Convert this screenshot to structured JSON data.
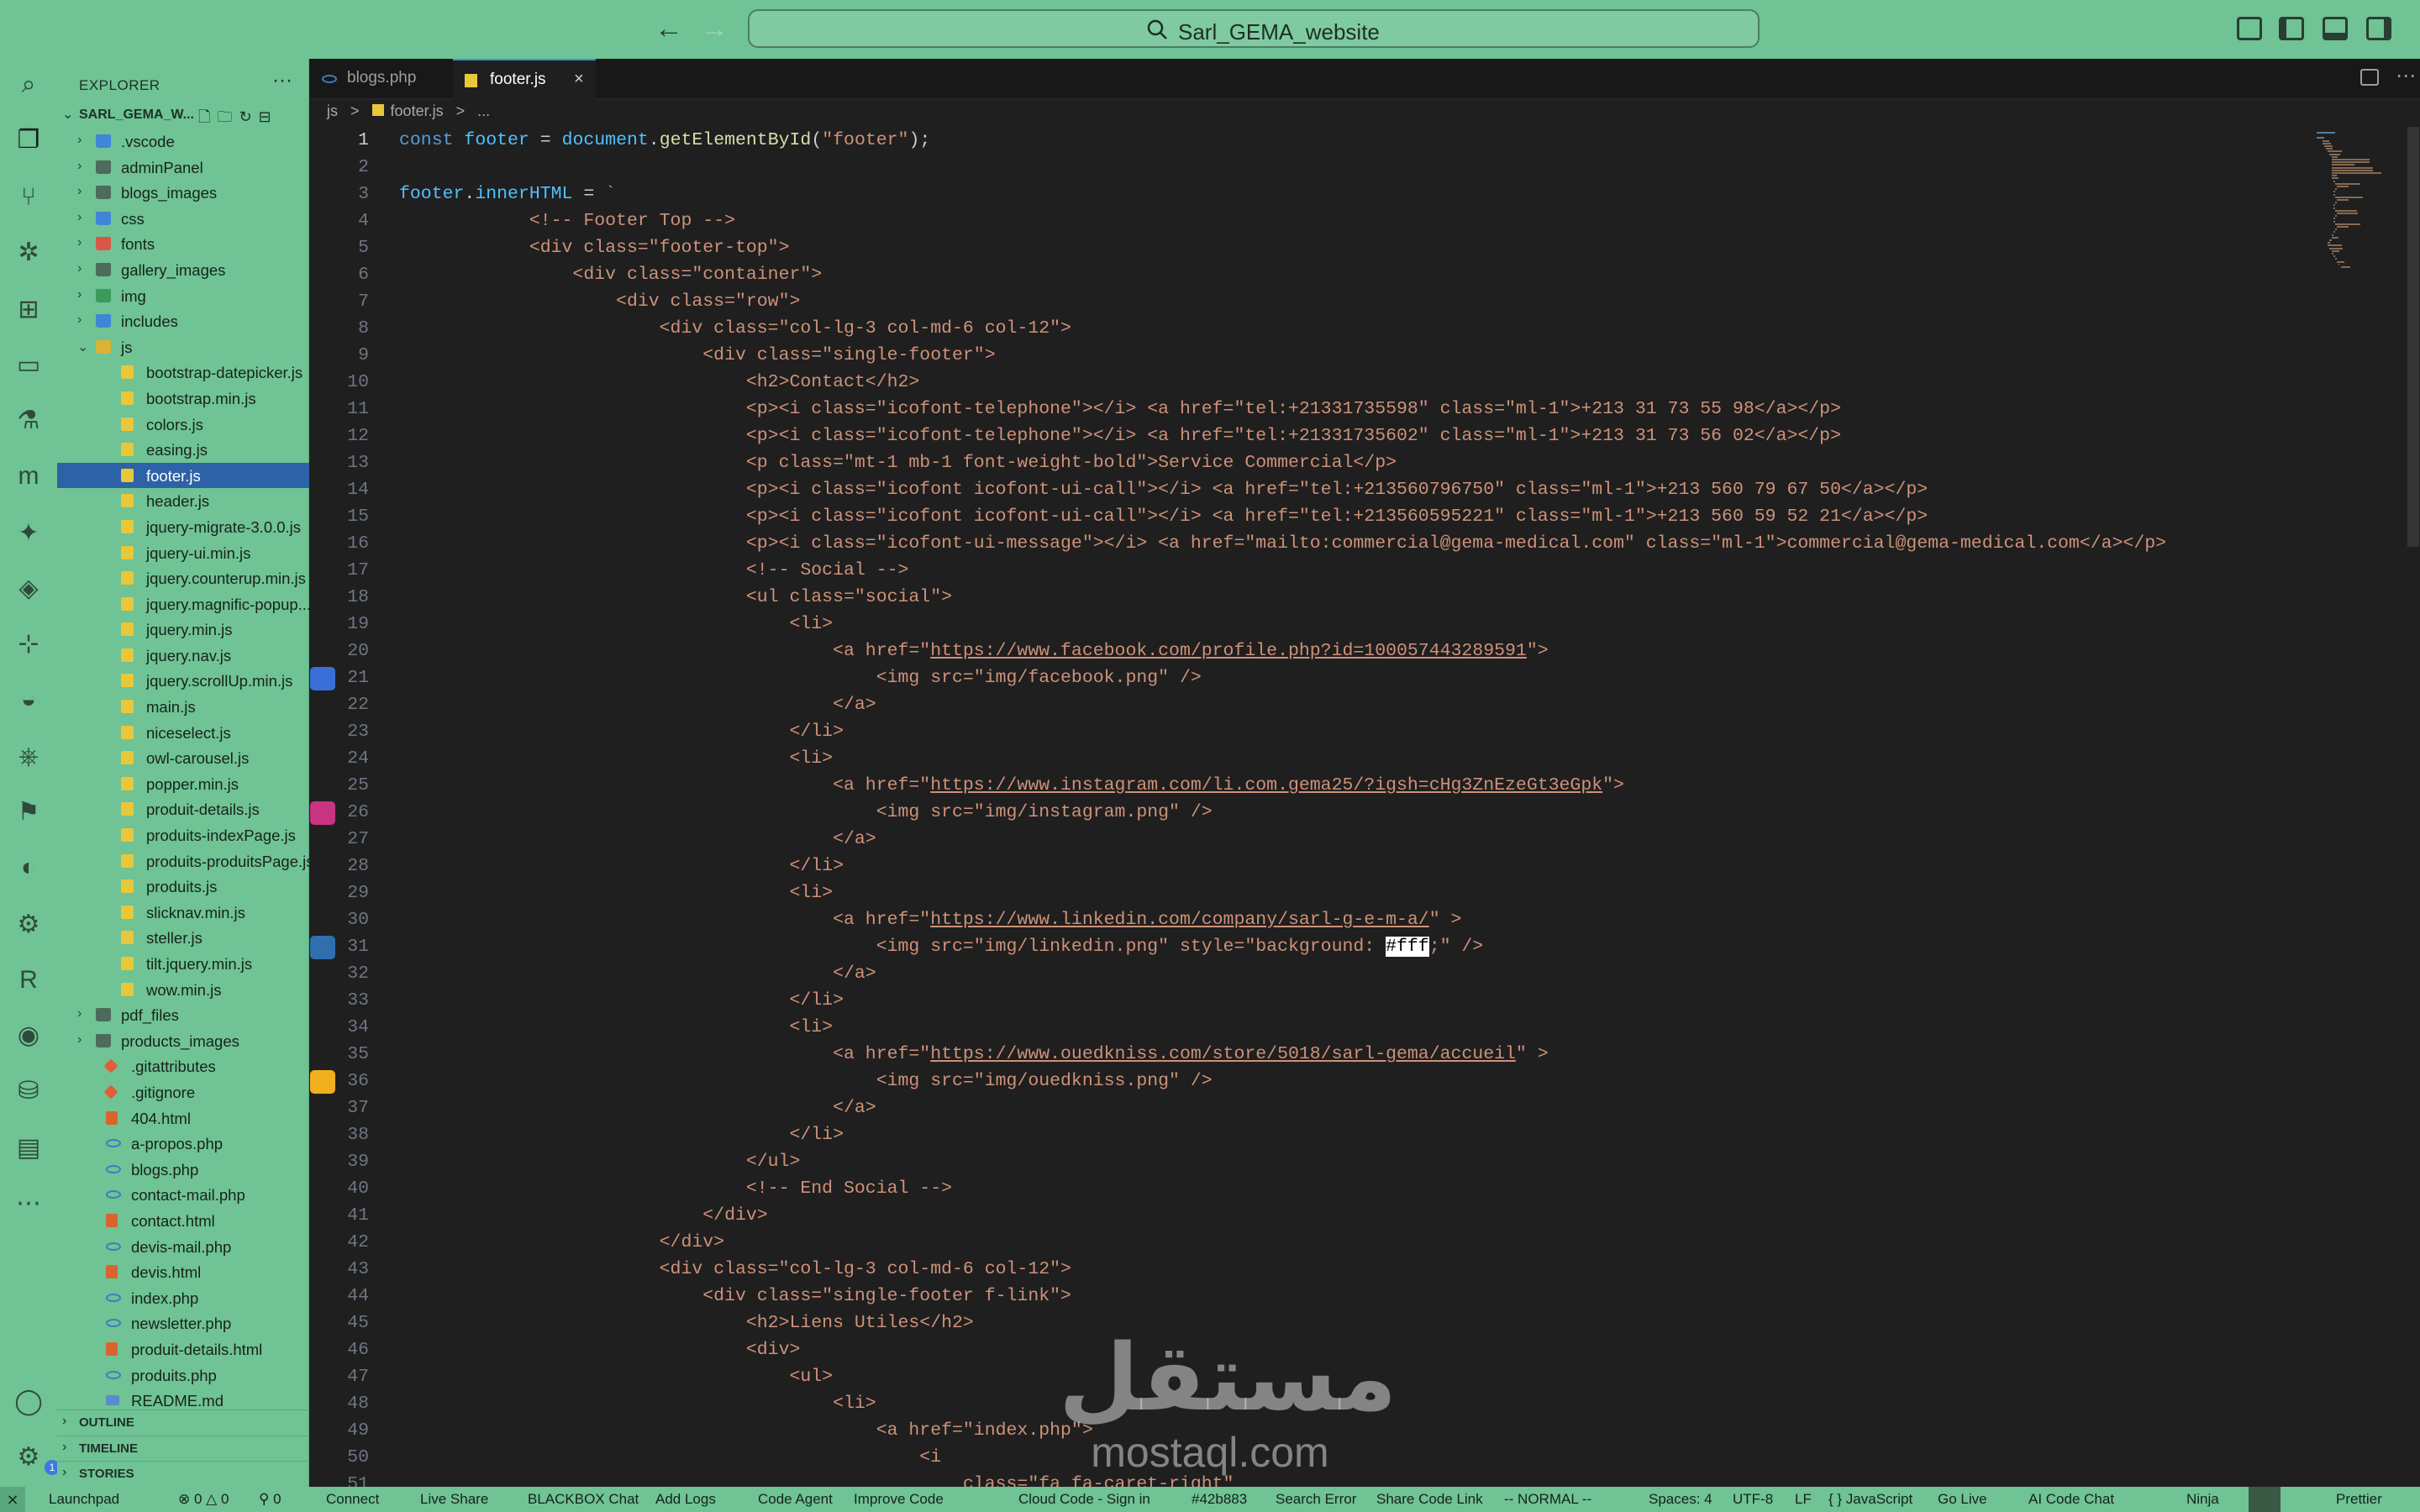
{
  "titlebar": {
    "back_icon": "arrow-left-icon",
    "forward_icon": "arrow-right-icon",
    "search_text": "Sarl_GEMA_website",
    "layout_icons": [
      "customize-layout-icon",
      "toggle-primary-sidebar-icon",
      "toggle-panel-icon",
      "toggle-secondary-sidebar-icon"
    ]
  },
  "activitybar": {
    "items": [
      "search-icon",
      "explorer-icon",
      "source-control-icon",
      "run-debug-icon",
      "extensions-icon",
      "remote-explorer-icon",
      "testing-icon",
      "m-icon",
      "sparkle-icon",
      "python-icon",
      "docker-icon",
      "whale-icon",
      "kubernetes-icon",
      "flag-icon",
      "edge-icon",
      "gear-app-icon",
      "r-icon",
      "github-icon",
      "database-icon",
      "stack-icon",
      "more-icon"
    ],
    "accounts_icon": "account-icon",
    "manage_icon": "manage-gear-icon",
    "manage_badge": "1"
  },
  "sidebar": {
    "title": "EXPLORER",
    "more": "···",
    "root": "SARL_GEMA_W...",
    "tree": [
      {
        "type": "folder",
        "name": ".vscode",
        "color": "blue",
        "depth": 0,
        "open": false
      },
      {
        "type": "folder",
        "name": "adminPanel",
        "color": "plain",
        "depth": 0,
        "open": false
      },
      {
        "type": "folder",
        "name": "blogs_images",
        "color": "plain",
        "depth": 0,
        "open": false
      },
      {
        "type": "folder",
        "name": "css",
        "color": "blue",
        "depth": 0,
        "open": false
      },
      {
        "type": "folder",
        "name": "fonts",
        "color": "red",
        "depth": 0,
        "open": false
      },
      {
        "type": "folder",
        "name": "gallery_images",
        "color": "plain",
        "depth": 0,
        "open": false
      },
      {
        "type": "folder",
        "name": "img",
        "color": "green",
        "depth": 0,
        "open": false
      },
      {
        "type": "folder",
        "name": "includes",
        "color": "blue",
        "depth": 0,
        "open": false
      },
      {
        "type": "folder",
        "name": "js",
        "color": "js",
        "depth": 0,
        "open": true
      },
      {
        "type": "js",
        "name": "bootstrap-datepicker.js",
        "depth": 1
      },
      {
        "type": "js",
        "name": "bootstrap.min.js",
        "depth": 1
      },
      {
        "type": "js",
        "name": "colors.js",
        "depth": 1
      },
      {
        "type": "js",
        "name": "easing.js",
        "depth": 1
      },
      {
        "type": "js",
        "name": "footer.js",
        "depth": 1,
        "selected": true
      },
      {
        "type": "js",
        "name": "header.js",
        "depth": 1
      },
      {
        "type": "js",
        "name": "jquery-migrate-3.0.0.js",
        "depth": 1
      },
      {
        "type": "js",
        "name": "jquery-ui.min.js",
        "depth": 1
      },
      {
        "type": "js",
        "name": "jquery.counterup.min.js",
        "depth": 1
      },
      {
        "type": "js",
        "name": "jquery.magnific-popup....",
        "depth": 1
      },
      {
        "type": "js",
        "name": "jquery.min.js",
        "depth": 1
      },
      {
        "type": "js",
        "name": "jquery.nav.js",
        "depth": 1
      },
      {
        "type": "js",
        "name": "jquery.scrollUp.min.js",
        "depth": 1
      },
      {
        "type": "js",
        "name": "main.js",
        "depth": 1
      },
      {
        "type": "js",
        "name": "niceselect.js",
        "depth": 1
      },
      {
        "type": "js",
        "name": "owl-carousel.js",
        "depth": 1
      },
      {
        "type": "js",
        "name": "popper.min.js",
        "depth": 1
      },
      {
        "type": "js",
        "name": "produit-details.js",
        "depth": 1
      },
      {
        "type": "js",
        "name": "produits-indexPage.js",
        "depth": 1
      },
      {
        "type": "js",
        "name": "produits-produitsPage.js",
        "depth": 1
      },
      {
        "type": "js",
        "name": "produits.js",
        "depth": 1
      },
      {
        "type": "js",
        "name": "slicknav.min.js",
        "depth": 1
      },
      {
        "type": "js",
        "name": "steller.js",
        "depth": 1
      },
      {
        "type": "js",
        "name": "tilt.jquery.min.js",
        "depth": 1
      },
      {
        "type": "js",
        "name": "wow.min.js",
        "depth": 1
      },
      {
        "type": "folder",
        "name": "pdf_files",
        "color": "plain",
        "depth": 0,
        "open": false
      },
      {
        "type": "folder",
        "name": "products_images",
        "color": "plain",
        "depth": 0,
        "open": false
      },
      {
        "type": "git",
        "name": ".gitattributes",
        "depth": 0
      },
      {
        "type": "git",
        "name": ".gitignore",
        "depth": 0
      },
      {
        "type": "html",
        "name": "404.html",
        "depth": 0
      },
      {
        "type": "php",
        "name": "a-propos.php",
        "depth": 0
      },
      {
        "type": "php",
        "name": "blogs.php",
        "depth": 0
      },
      {
        "type": "php",
        "name": "contact-mail.php",
        "depth": 0
      },
      {
        "type": "html",
        "name": "contact.html",
        "depth": 0
      },
      {
        "type": "php",
        "name": "devis-mail.php",
        "depth": 0
      },
      {
        "type": "html",
        "name": "devis.html",
        "depth": 0
      },
      {
        "type": "php",
        "name": "index.php",
        "depth": 0
      },
      {
        "type": "php",
        "name": "newsletter.php",
        "depth": 0
      },
      {
        "type": "html",
        "name": "produit-details.html",
        "depth": 0
      },
      {
        "type": "php",
        "name": "produits.php",
        "depth": 0
      },
      {
        "type": "md",
        "name": "README.md",
        "depth": 0
      }
    ],
    "sections": [
      "OUTLINE",
      "TIMELINE",
      "STORIES"
    ]
  },
  "editor": {
    "tabs": [
      {
        "label": "blogs.php",
        "active": false
      },
      {
        "label": "footer.js",
        "active": true
      }
    ],
    "close_glyph": "×",
    "breadcrumb": [
      "js",
      ">",
      "footer.js",
      ">",
      "..."
    ],
    "current_line": 1,
    "lines": [
      [
        [
          "kw",
          "const "
        ],
        [
          "var",
          "footer"
        ],
        [
          "p",
          " = "
        ],
        [
          "var",
          "document"
        ],
        [
          "p",
          "."
        ],
        [
          "fn",
          "getElementById"
        ],
        [
          "p",
          "("
        ],
        [
          "str",
          "\"footer\""
        ],
        [
          "p",
          ");"
        ]
      ],
      [],
      [
        [
          "var",
          "footer"
        ],
        [
          "p",
          "."
        ],
        [
          "var",
          "innerHTML"
        ],
        [
          "p",
          " = "
        ],
        [
          "str",
          "`"
        ]
      ],
      [
        [
          "str",
          "            <!-- Footer Top -->"
        ]
      ],
      [
        [
          "str",
          "            <div class=\"footer-top\">"
        ]
      ],
      [
        [
          "str",
          "                <div class=\"container\">"
        ]
      ],
      [
        [
          "str",
          "                    <div class=\"row\">"
        ]
      ],
      [
        [
          "str",
          "                        <div class=\"col-lg-3 col-md-6 col-12\">"
        ]
      ],
      [
        [
          "str",
          "                            <div class=\"single-footer\">"
        ]
      ],
      [
        [
          "str",
          "                                <h2>Contact</h2>"
        ]
      ],
      [
        [
          "str",
          "                                <p><i class=\"icofont-telephone\"></i> <a href=\"tel:+21331735598\" class=\"ml-1\">+213 31 73 55 98</a></p>"
        ]
      ],
      [
        [
          "str",
          "                                <p><i class=\"icofont-telephone\"></i> <a href=\"tel:+21331735602\" class=\"ml-1\">+213 31 73 56 02</a></p>"
        ]
      ],
      [
        [
          "str",
          "                                <p class=\"mt-1 mb-1 font-weight-bold\">Service Commercial</p>"
        ]
      ],
      [
        [
          "str",
          "                                <p><i class=\"icofont icofont-ui-call\"></i> <a href=\"tel:+213560796750\" class=\"ml-1\">+213 560 79 67 50</a></p>"
        ]
      ],
      [
        [
          "str",
          "                                <p><i class=\"icofont icofont-ui-call\"></i> <a href=\"tel:+213560595221\" class=\"ml-1\">+213 560 59 52 21</a></p>"
        ]
      ],
      [
        [
          "str",
          "                                <p><i class=\"icofont-ui-message\"></i> <a href=\"mailto:commercial@gema-medical.com\" class=\"ml-1\">commercial@gema-medical.com</a></p>"
        ]
      ],
      [
        [
          "str",
          "                                <!-- Social -->"
        ]
      ],
      [
        [
          "str",
          "                                <ul class=\"social\">"
        ]
      ],
      [
        [
          "str",
          "                                    <li>"
        ]
      ],
      [
        [
          "str",
          "                                        <a href=\""
        ],
        [
          "url",
          "https://www.facebook.com/profile.php?id=100057443289591"
        ],
        [
          "str",
          "\">"
        ]
      ],
      [
        [
          "str",
          "                                            <img src=\"img/facebook.png\" />"
        ]
      ],
      [
        [
          "str",
          "                                        </a>"
        ]
      ],
      [
        [
          "str",
          "                                    </li>"
        ]
      ],
      [
        [
          "str",
          "                                    <li>"
        ]
      ],
      [
        [
          "str",
          "                                        <a href=\""
        ],
        [
          "url",
          "https://www.instagram.com/li.com.gema25/?igsh=cHg3ZnEzeGt3eGpk"
        ],
        [
          "str",
          "\">"
        ]
      ],
      [
        [
          "str",
          "                                            <img src=\"img/instagram.png\" />"
        ]
      ],
      [
        [
          "str",
          "                                        </a>"
        ]
      ],
      [
        [
          "str",
          "                                    </li>"
        ]
      ],
      [
        [
          "str",
          "                                    <li>"
        ]
      ],
      [
        [
          "str",
          "                                        <a href=\""
        ],
        [
          "url",
          "https://www.linkedin.com/company/sarl-g-e-m-a/"
        ],
        [
          "str",
          "\" >"
        ]
      ],
      [
        [
          "str",
          "                                            <img src=\"img/linkedin.png\" style=\"background: "
        ],
        [
          "sel",
          "#fff"
        ],
        [
          "str",
          ";\" />"
        ]
      ],
      [
        [
          "str",
          "                                        </a>"
        ]
      ],
      [
        [
          "str",
          "                                    </li>"
        ]
      ],
      [
        [
          "str",
          "                                    <li>"
        ]
      ],
      [
        [
          "str",
          "                                        <a href=\""
        ],
        [
          "url",
          "https://www.ouedkniss.com/store/5018/sarl-gema/accueil"
        ],
        [
          "str",
          "\" >"
        ]
      ],
      [
        [
          "str",
          "                                            <img src=\"img/ouedkniss.png\" />"
        ]
      ],
      [
        [
          "str",
          "                                        </a>"
        ]
      ],
      [
        [
          "str",
          "                                    </li>"
        ]
      ],
      [
        [
          "str",
          "                                </ul>"
        ]
      ],
      [
        [
          "str",
          "                                <!-- End Social -->"
        ]
      ],
      [
        [
          "str",
          "                            </div>"
        ]
      ],
      [
        [
          "str",
          "                        </div>"
        ]
      ],
      [
        [
          "str",
          "                        <div class=\"col-lg-3 col-md-6 col-12\">"
        ]
      ],
      [
        [
          "str",
          "                            <div class=\"single-footer f-link\">"
        ]
      ],
      [
        [
          "str",
          "                                <h2>Liens Utiles</h2>"
        ]
      ],
      [
        [
          "str",
          "                                <div>"
        ]
      ],
      [
        [
          "str",
          "                                    <ul>"
        ]
      ],
      [
        [
          "str",
          "                                        <li>"
        ]
      ],
      [
        [
          "str",
          "                                            <a href=\"index.php\">"
        ]
      ],
      [
        [
          "str",
          "                                                <i"
        ]
      ],
      [
        [
          "str",
          "                                                    class=\"fa fa-caret-right\""
        ]
      ]
    ],
    "gutter_icons": [
      {
        "line": 21,
        "icon": "facebook-icon",
        "color": "#3b6fd8"
      },
      {
        "line": 26,
        "icon": "instagram-icon",
        "color": "#c8347f"
      },
      {
        "line": 31,
        "icon": "linkedin-icon",
        "color": "#2f6fb0"
      },
      {
        "line": 36,
        "icon": "ouedkniss-icon",
        "color": "#f2b01e"
      }
    ]
  },
  "statusbar": {
    "left": [
      "Launchpad",
      "⊗ 0 △ 0",
      "⚲ 0",
      "Connect",
      "Live Share",
      "BLACKBOX Chat",
      "Add Logs",
      "Code Agent",
      "Improve Code",
      "Cloud Code - Sign in",
      "#42b883",
      "Search Error",
      "Share Code Link",
      "-- NORMAL --"
    ],
    "right": [
      "Spaces: 4",
      "UTF-8",
      "LF",
      "{ } JavaScript",
      "Go Live",
      "AI Code Chat",
      "Ninja",
      "Prettier"
    ]
  },
  "watermark": {
    "arabic": "مستقل",
    "latin": "mostaql.com"
  },
  "colors": {
    "accent_green": "#6fc394",
    "editor_bg": "#1f1f1f",
    "selection_blue": "#2d62a8"
  }
}
